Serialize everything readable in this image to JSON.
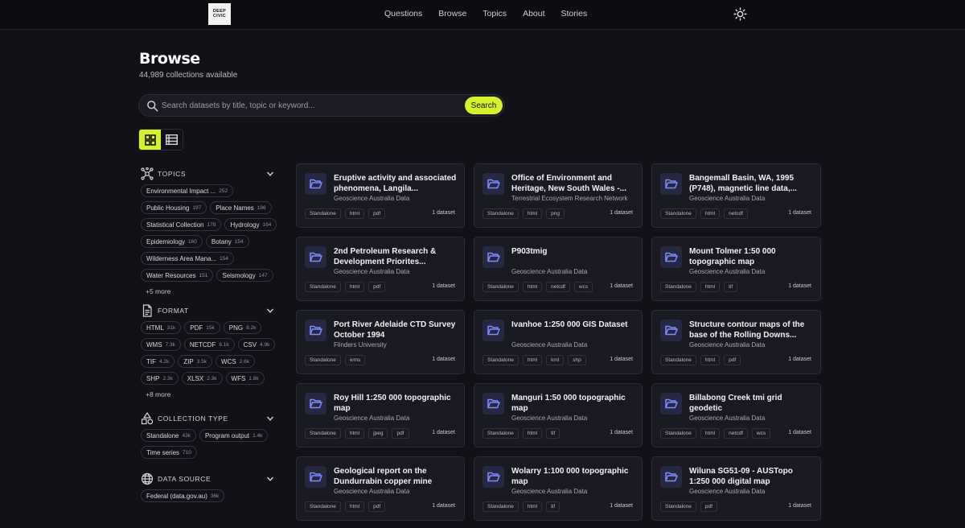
{
  "brand": {
    "line1": "DEEP",
    "line2": "CIVIC"
  },
  "nav": [
    "Questions",
    "Browse",
    "Topics",
    "About",
    "Stories"
  ],
  "header": {
    "title": "Browse",
    "subtitle": "44,989 collections available"
  },
  "search": {
    "placeholder": "Search datasets by title, topic or keyword...",
    "button": "Search"
  },
  "colors": {
    "accent": "#d5f031",
    "background": "#111218",
    "card": "#191a21",
    "folder": "#7f8cff"
  },
  "facets": [
    {
      "title": "TOPICS",
      "icon": "network-icon",
      "chips": [
        {
          "label": "Environmental Impact ...",
          "count": "252"
        },
        {
          "label": "Public Housing",
          "count": "197"
        },
        {
          "label": "Place Names",
          "count": "196"
        },
        {
          "label": "Statistical Collection",
          "count": "178"
        },
        {
          "label": "Hydrology",
          "count": "164"
        },
        {
          "label": "Epidemiology",
          "count": "160"
        },
        {
          "label": "Botany",
          "count": "154"
        },
        {
          "label": "Wilderness Area Mana...",
          "count": "154"
        },
        {
          "label": "Water Resources",
          "count": "151"
        },
        {
          "label": "Seismology",
          "count": "147"
        }
      ],
      "more": "+5 more"
    },
    {
      "title": "FORMAT",
      "icon": "document-icon",
      "chips": [
        {
          "label": "HTML",
          "count": "31k"
        },
        {
          "label": "PDF",
          "count": "15k"
        },
        {
          "label": "PNG",
          "count": "8.2k"
        },
        {
          "label": "WMS",
          "count": "7.3k"
        },
        {
          "label": "NETCDF",
          "count": "6.1k"
        },
        {
          "label": "CSV",
          "count": "4.9k"
        },
        {
          "label": "TIF",
          "count": "4.2k"
        },
        {
          "label": "ZIP",
          "count": "3.5k"
        },
        {
          "label": "WCS",
          "count": "2.6k"
        },
        {
          "label": "SHP",
          "count": "2.3k"
        },
        {
          "label": "XLSX",
          "count": "2.3k"
        },
        {
          "label": "WFS",
          "count": "1.8k"
        }
      ],
      "more": "+8 more"
    },
    {
      "title": "COLLECTION TYPE",
      "icon": "shapes-icon",
      "chips": [
        {
          "label": "Standalone",
          "count": "43k"
        },
        {
          "label": "Program output",
          "count": "1.4k"
        },
        {
          "label": "Time series",
          "count": "710"
        }
      ],
      "more": ""
    },
    {
      "title": "DATA SOURCE",
      "icon": "globe-icon",
      "chips": [
        {
          "label": "Federal (data.gov.au)",
          "count": "36k"
        }
      ],
      "more": ""
    }
  ],
  "cards": [
    {
      "title": "Eruptive activity and associated phenomena, Langila...",
      "source": "Geoscience Australia Data",
      "tags": [
        "Standalone",
        "html",
        "pdf"
      ],
      "count": "1 dataset"
    },
    {
      "title": "Office of Environment and Heritage, New South Wales -...",
      "source": "Terrestrial Ecosystem Research Network",
      "tags": [
        "Standalone",
        "html",
        "png"
      ],
      "count": "1 dataset"
    },
    {
      "title": "Bangemall Basin, WA, 1995 (P748), magnetic line data,...",
      "source": "Geoscience Australia Data",
      "tags": [
        "Standalone",
        "html",
        "netcdf"
      ],
      "count": "1 dataset"
    },
    {
      "title": "2nd Petroleum Research & Development Priorites...",
      "source": "Geoscience Australia Data",
      "tags": [
        "Standalone",
        "html",
        "pdf"
      ],
      "count": "1 dataset"
    },
    {
      "title": "P903tmig",
      "source": "Geoscience Australia Data",
      "tags": [
        "Standalone",
        "html",
        "netcdf",
        "wcs"
      ],
      "count": "1 dataset"
    },
    {
      "title": "Mount Tolmer 1:50 000 topographic map",
      "source": "Geoscience Australia Data",
      "tags": [
        "Standalone",
        "html",
        "tif"
      ],
      "count": "1 dataset"
    },
    {
      "title": "Port River Adelaide CTD Survey October 1994",
      "source": "Flinders University",
      "tags": [
        "Standalone",
        "wms"
      ],
      "count": "1 dataset"
    },
    {
      "title": "Ivanhoe 1:250 000 GIS Dataset",
      "source": "Geoscience Australia Data",
      "tags": [
        "Standalone",
        "html",
        "kml",
        "shp"
      ],
      "count": "1 dataset"
    },
    {
      "title": "Structure contour maps of the base of the Rolling Downs...",
      "source": "Geoscience Australia Data",
      "tags": [
        "Standalone",
        "html",
        "pdf"
      ],
      "count": "1 dataset"
    },
    {
      "title": "Roy Hill 1:250 000 topographic map",
      "source": "Geoscience Australia Data",
      "tags": [
        "Standalone",
        "html",
        "jpeg",
        "pdf"
      ],
      "count": "1 dataset"
    },
    {
      "title": "Manguri 1:50 000 topographic map",
      "source": "Geoscience Australia Data",
      "tags": [
        "Standalone",
        "html",
        "tif"
      ],
      "count": "1 dataset"
    },
    {
      "title": "Billabong Creek tmi grid geodetic",
      "source": "Geoscience Australia Data",
      "tags": [
        "Standalone",
        "html",
        "netcdf",
        "wcs"
      ],
      "count": "1 dataset"
    },
    {
      "title": "Geological report on the Dundurrabin copper mine",
      "source": "Geoscience Australia Data",
      "tags": [
        "Standalone",
        "html",
        "pdf"
      ],
      "count": "1 dataset"
    },
    {
      "title": "Wolarry 1:100 000 topographic map",
      "source": "Geoscience Australia Data",
      "tags": [
        "Standalone",
        "html",
        "tif"
      ],
      "count": "1 dataset"
    },
    {
      "title": "Wiluna SG51-09 - AUSTopo 1:250 000 digital map",
      "source": "Geoscience Australia Data",
      "tags": [
        "Standalone",
        "pdf"
      ],
      "count": "1 dataset"
    }
  ]
}
